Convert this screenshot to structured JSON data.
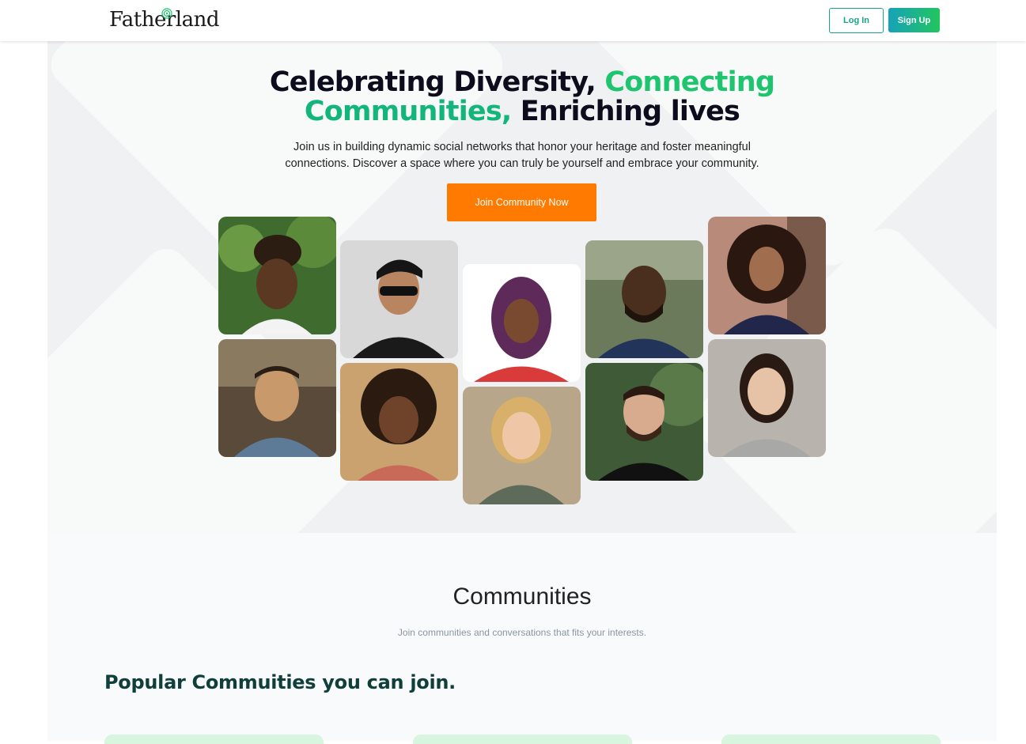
{
  "header": {
    "logo_text": "Fatherland",
    "login_label": "Log In",
    "signup_label": "Sign Up"
  },
  "hero": {
    "title_part1": "Celebrating Diversity, ",
    "title_part2": "Connecting",
    "title_part3": "Communities, ",
    "title_part4": "Enriching lives",
    "subtitle": "Join us in building dynamic social networks that honor your heritage and foster meaningful connections. Discover a space where you can truly be yourself and embrace your community.",
    "cta_label": "Join Community Now"
  },
  "communities": {
    "title": "Communities",
    "subtitle": "Join communities and conversations that fits your interests.",
    "popular_heading": "Popular Commuities you can join."
  },
  "colors": {
    "brand_green": "#1ec46e",
    "cta_orange": "#ff7a00",
    "login_teal": "#17a589"
  }
}
